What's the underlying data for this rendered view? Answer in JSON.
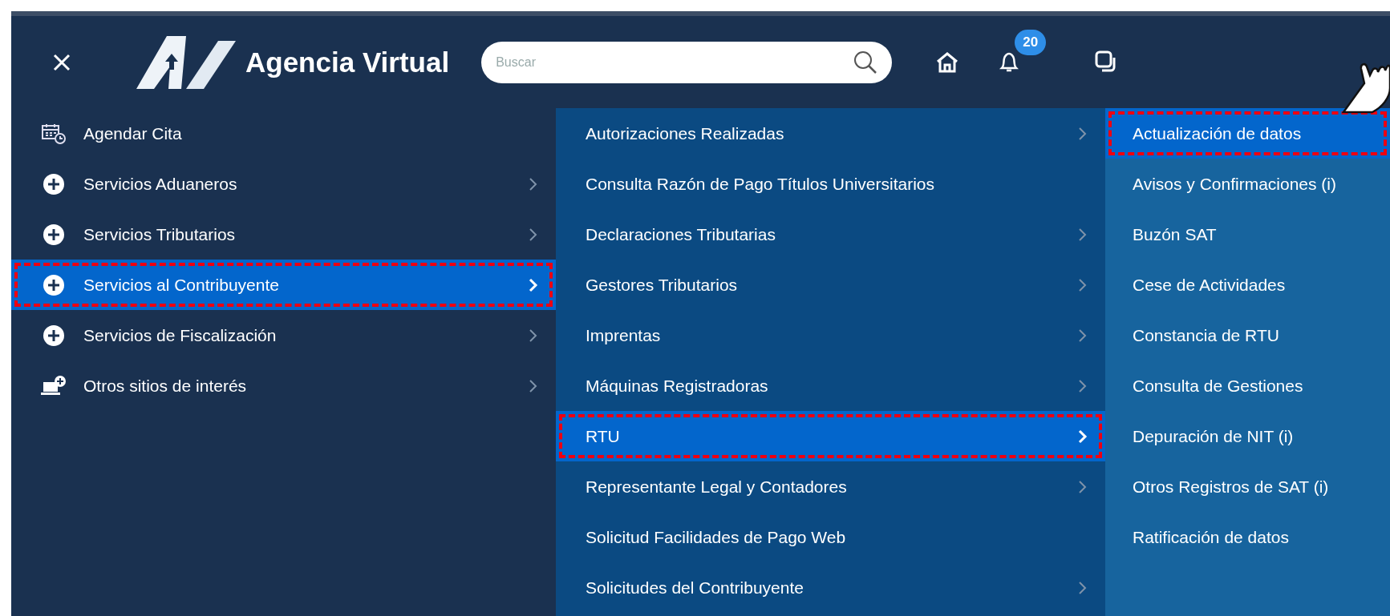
{
  "header": {
    "title": "Agencia Virtual",
    "search": {
      "placeholder": "Buscar"
    },
    "notifications": {
      "count": "20"
    }
  },
  "menu_levels": [
    {
      "items": [
        {
          "kind": "calendar",
          "label": "Agendar Cita",
          "has_submenu": false,
          "selected": false,
          "annotated": false
        },
        {
          "kind": "plus",
          "label": "Servicios Aduaneros",
          "has_submenu": true,
          "selected": false,
          "annotated": false
        },
        {
          "kind": "plus",
          "label": "Servicios Tributarios",
          "has_submenu": true,
          "selected": false,
          "annotated": false
        },
        {
          "kind": "plus",
          "label": "Servicios al Contribuyente",
          "has_submenu": true,
          "selected": true,
          "annotated": true
        },
        {
          "kind": "plus",
          "label": "Servicios de Fiscalización",
          "has_submenu": true,
          "selected": false,
          "annotated": false
        },
        {
          "kind": "laptop",
          "label": "Otros sitios de interés",
          "has_submenu": true,
          "selected": false,
          "annotated": false
        }
      ]
    },
    {
      "items": [
        {
          "label": "Autorizaciones Realizadas",
          "has_submenu": true,
          "selected": false,
          "annotated": false
        },
        {
          "label": "Consulta Razón de Pago Títulos Universitarios",
          "has_submenu": false,
          "selected": false,
          "annotated": false
        },
        {
          "label": "Declaraciones Tributarias",
          "has_submenu": true,
          "selected": false,
          "annotated": false
        },
        {
          "label": "Gestores Tributarios",
          "has_submenu": true,
          "selected": false,
          "annotated": false
        },
        {
          "label": "Imprentas",
          "has_submenu": true,
          "selected": false,
          "annotated": false
        },
        {
          "label": "Máquinas Registradoras",
          "has_submenu": true,
          "selected": false,
          "annotated": false
        },
        {
          "label": "RTU",
          "has_submenu": true,
          "selected": true,
          "annotated": true
        },
        {
          "label": "Representante Legal y Contadores",
          "has_submenu": true,
          "selected": false,
          "annotated": false
        },
        {
          "label": "Solicitud Facilidades de Pago Web",
          "has_submenu": false,
          "selected": false,
          "annotated": false
        },
        {
          "label": "Solicitudes del Contribuyente",
          "has_submenu": true,
          "selected": false,
          "annotated": false
        }
      ]
    },
    {
      "items": [
        {
          "label": "Actualización de datos",
          "has_submenu": false,
          "selected": true,
          "annotated": true
        },
        {
          "label": "Avisos y Confirmaciones (i)",
          "has_submenu": false,
          "selected": false,
          "annotated": false
        },
        {
          "label": "Buzón SAT",
          "has_submenu": false,
          "selected": false,
          "annotated": false
        },
        {
          "label": "Cese de Actividades",
          "has_submenu": false,
          "selected": false,
          "annotated": false
        },
        {
          "label": "Constancia de RTU",
          "has_submenu": false,
          "selected": false,
          "annotated": false
        },
        {
          "label": "Consulta de Gestiones",
          "has_submenu": false,
          "selected": false,
          "annotated": false
        },
        {
          "label": "Depuración de NIT (i)",
          "has_submenu": false,
          "selected": false,
          "annotated": false
        },
        {
          "label": "Otros Registros de SAT (i)",
          "has_submenu": false,
          "selected": false,
          "annotated": false
        },
        {
          "label": "Ratificación de datos",
          "has_submenu": false,
          "selected": false,
          "annotated": false
        }
      ]
    }
  ]
}
